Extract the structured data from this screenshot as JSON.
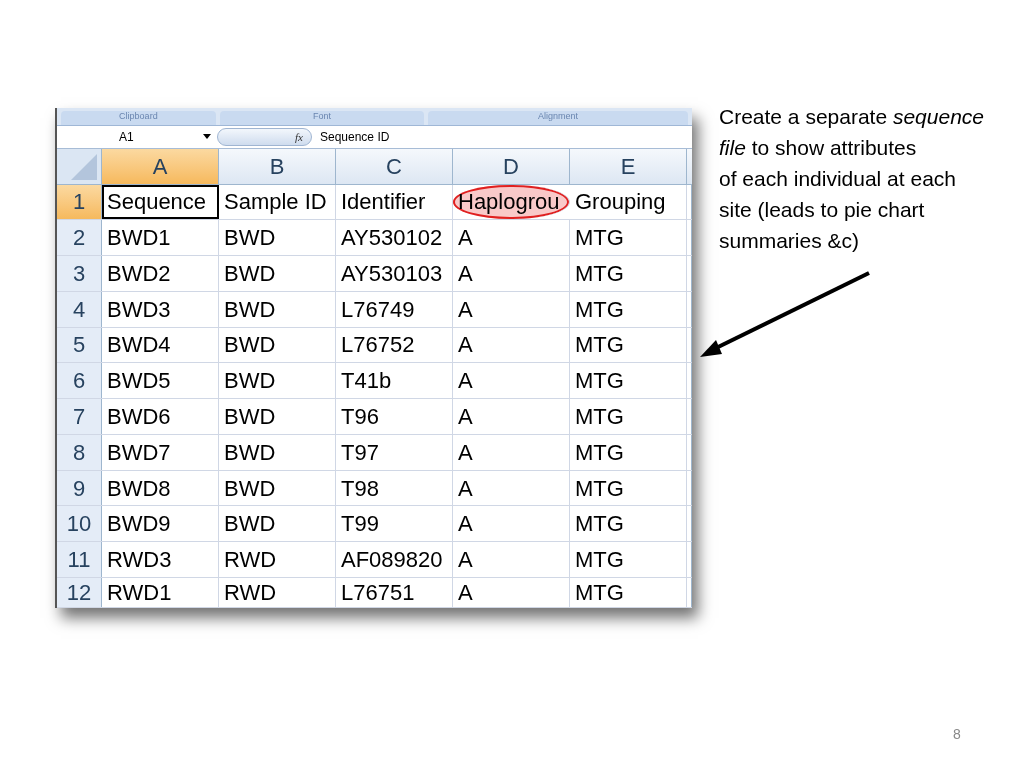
{
  "ribbon_groups": [
    "Clipboard",
    "Font",
    "Alignment"
  ],
  "formula_bar": {
    "name_box": "A1",
    "fx": "fx",
    "value": "Sequence ID"
  },
  "columns": [
    {
      "label": "A",
      "selected": true,
      "circled": false
    },
    {
      "label": "B",
      "selected": false,
      "circled": false
    },
    {
      "label": "C",
      "selected": false,
      "circled": false
    },
    {
      "label": "D",
      "selected": false,
      "circled": true
    },
    {
      "label": "E",
      "selected": false,
      "circled": false
    }
  ],
  "rows": [
    {
      "number": "1",
      "selected": true,
      "cells": [
        "Sequence",
        "Sample ID",
        "Identifier",
        "Haplogrou",
        "Grouping"
      ]
    },
    {
      "number": "2",
      "selected": false,
      "cells": [
        "BWD1",
        "BWD",
        "AY530102",
        "A",
        "MTG"
      ]
    },
    {
      "number": "3",
      "selected": false,
      "cells": [
        "BWD2",
        "BWD",
        "AY530103",
        "A",
        "MTG"
      ]
    },
    {
      "number": "4",
      "selected": false,
      "cells": [
        "BWD3",
        "BWD",
        "L76749",
        "A",
        "MTG"
      ]
    },
    {
      "number": "5",
      "selected": false,
      "cells": [
        "BWD4",
        "BWD",
        "L76752",
        "A",
        "MTG"
      ]
    },
    {
      "number": "6",
      "selected": false,
      "cells": [
        "BWD5",
        "BWD",
        "T41b",
        "A",
        "MTG"
      ]
    },
    {
      "number": "7",
      "selected": false,
      "cells": [
        "BWD6",
        "BWD",
        "T96",
        "A",
        "MTG"
      ]
    },
    {
      "number": "8",
      "selected": false,
      "cells": [
        "BWD7",
        "BWD",
        "T97",
        "A",
        "MTG"
      ]
    },
    {
      "number": "9",
      "selected": false,
      "cells": [
        "BWD8",
        "BWD",
        "T98",
        "A",
        "MTG"
      ]
    },
    {
      "number": "10",
      "selected": false,
      "cells": [
        "BWD9",
        "BWD",
        "T99",
        "A",
        "MTG"
      ]
    },
    {
      "number": "11",
      "selected": false,
      "cells": [
        "RWD3",
        "RWD",
        "AF089820",
        "A",
        "MTG"
      ]
    },
    {
      "number": "12",
      "selected": false,
      "cells": [
        "RWD1",
        "RWD",
        "L76751",
        "A",
        "MTG"
      ]
    }
  ],
  "note": {
    "lines": [
      "Create a separate *sequence*",
      "*file* to show attributes",
      "of each individual at each",
      "site (leads to pie chart",
      "summaries &c)"
    ]
  },
  "page_number": "8"
}
